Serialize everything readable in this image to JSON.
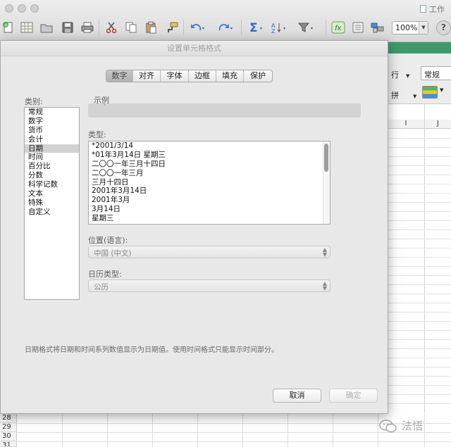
{
  "window": {
    "title": "工作",
    "zoom": "100%"
  },
  "toolbar": {
    "icons": [
      "new-icon",
      "gallery-icon",
      "open-icon",
      "save-icon",
      "print-icon",
      "cut-icon",
      "copy-icon",
      "paste-icon",
      "format-painter-icon",
      "undo-icon",
      "redo-icon",
      "autosum-icon",
      "sort-icon",
      "filter-icon",
      "function-icon",
      "toolbox-icon",
      "media-icon",
      "help-icon"
    ]
  },
  "ribbon": {
    "wrap_label": "行",
    "merge_label": "拼",
    "number_format": "常规"
  },
  "sheet": {
    "columns": [
      "I",
      "J"
    ],
    "rows": [
      "28",
      "29",
      "30",
      "31"
    ]
  },
  "dialog": {
    "title": "设置单元格格式",
    "tabs": [
      "数字",
      "对齐",
      "字体",
      "边框",
      "填充",
      "保护"
    ],
    "active_tab": "数字",
    "category_label": "类别:",
    "categories": [
      "常规",
      "数字",
      "货币",
      "会计",
      "日期",
      "时间",
      "百分比",
      "分数",
      "科学记数",
      "文本",
      "特殊",
      "自定义"
    ],
    "selected_category": "日期",
    "sample_label": "示例",
    "sample_value": "`",
    "type_label": "类型:",
    "types": [
      "*2001/3/14",
      "*01年3月14日 星期三",
      "二〇〇一年三月十四日",
      "二〇〇一年三月",
      "三月十四日",
      "2001年3月14日",
      "2001年3月",
      "3月14日",
      "星期三"
    ],
    "locale_label": "位置(语言):",
    "locale_value": "中国 (中文)",
    "calendar_label": "日历类型:",
    "calendar_value": "公历",
    "description": "日期格式将日期和时间系列数值显示为日期值。使用时间格式只能显示时间部分。",
    "cancel_label": "取消",
    "ok_label": "确定"
  },
  "watermark": {
    "text": "法悟"
  }
}
